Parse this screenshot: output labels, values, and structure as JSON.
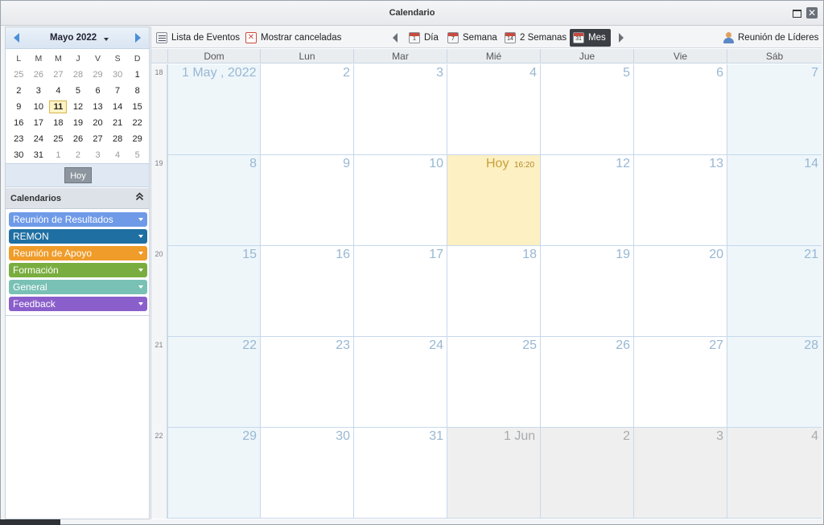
{
  "window": {
    "title": "Calendario",
    "close_glyph": "✕"
  },
  "mini_calendar": {
    "month_label": "Mayo 2022",
    "weekday_headers": [
      "L",
      "M",
      "M",
      "J",
      "V",
      "S",
      "D"
    ],
    "weeks": [
      [
        {
          "d": "25",
          "o": true
        },
        {
          "d": "26",
          "o": true
        },
        {
          "d": "27",
          "o": true
        },
        {
          "d": "28",
          "o": true
        },
        {
          "d": "29",
          "o": true
        },
        {
          "d": "30",
          "o": true
        },
        {
          "d": "1",
          "o": false
        }
      ],
      [
        {
          "d": "2",
          "o": false
        },
        {
          "d": "3",
          "o": false
        },
        {
          "d": "4",
          "o": false
        },
        {
          "d": "5",
          "o": false
        },
        {
          "d": "6",
          "o": false
        },
        {
          "d": "7",
          "o": false
        },
        {
          "d": "8",
          "o": false
        }
      ],
      [
        {
          "d": "9",
          "o": false
        },
        {
          "d": "10",
          "o": false
        },
        {
          "d": "11",
          "o": false,
          "today": true
        },
        {
          "d": "12",
          "o": false
        },
        {
          "d": "13",
          "o": false
        },
        {
          "d": "14",
          "o": false
        },
        {
          "d": "15",
          "o": false
        }
      ],
      [
        {
          "d": "16",
          "o": false
        },
        {
          "d": "17",
          "o": false
        },
        {
          "d": "18",
          "o": false
        },
        {
          "d": "19",
          "o": false
        },
        {
          "d": "20",
          "o": false
        },
        {
          "d": "21",
          "o": false
        },
        {
          "d": "22",
          "o": false
        }
      ],
      [
        {
          "d": "23",
          "o": false
        },
        {
          "d": "24",
          "o": false
        },
        {
          "d": "25",
          "o": false
        },
        {
          "d": "26",
          "o": false
        },
        {
          "d": "27",
          "o": false
        },
        {
          "d": "28",
          "o": false
        },
        {
          "d": "29",
          "o": false
        }
      ],
      [
        {
          "d": "30",
          "o": false
        },
        {
          "d": "31",
          "o": false
        },
        {
          "d": "1",
          "o": true
        },
        {
          "d": "2",
          "o": true
        },
        {
          "d": "3",
          "o": true
        },
        {
          "d": "4",
          "o": true
        },
        {
          "d": "5",
          "o": true
        }
      ]
    ],
    "today_button": "Hoy"
  },
  "calendars": {
    "section_label": "Calendarios",
    "collapse_glyph": "≈",
    "items": [
      {
        "label": "Reunión de Resultados",
        "color": "#6f9ae8"
      },
      {
        "label": "REMON",
        "color": "#1f6fa3"
      },
      {
        "label": "Reunión de Apoyo",
        "color": "#ef9c2a"
      },
      {
        "label": "Formación",
        "color": "#7aad3f"
      },
      {
        "label": "General",
        "color": "#79c1b5"
      },
      {
        "label": "Feedback",
        "color": "#8b5fcb"
      }
    ]
  },
  "toolbar": {
    "event_list": "Lista de Eventos",
    "show_cancelled": "Mostrar canceladas",
    "view_day": "Día",
    "view_week": "Semana",
    "view_two_weeks": "2 Semanas",
    "view_month": "Mes",
    "leaders_meeting": "Reunión de Líderes",
    "icon_day_num": "1",
    "icon_week_num": "7",
    "icon_two_weeks_num": "14",
    "icon_month_num": "31"
  },
  "month_view": {
    "weekdays": [
      "Dom",
      "Lun",
      "Mar",
      "Mié",
      "Jue",
      "Vie",
      "Sáb"
    ],
    "weeks": [
      {
        "num": "18",
        "days": [
          {
            "label": "1 May , 2022",
            "type": "weekend first"
          },
          {
            "label": "2",
            "type": ""
          },
          {
            "label": "3",
            "type": ""
          },
          {
            "label": "4",
            "type": ""
          },
          {
            "label": "5",
            "type": ""
          },
          {
            "label": "6",
            "type": ""
          },
          {
            "label": "7",
            "type": "weekend"
          }
        ]
      },
      {
        "num": "19",
        "days": [
          {
            "label": "8",
            "type": "weekend"
          },
          {
            "label": "9",
            "type": ""
          },
          {
            "label": "10",
            "type": ""
          },
          {
            "label": "Hoy",
            "type": "today",
            "time": "16:20"
          },
          {
            "label": "12",
            "type": ""
          },
          {
            "label": "13",
            "type": ""
          },
          {
            "label": "14",
            "type": "weekend"
          }
        ]
      },
      {
        "num": "20",
        "days": [
          {
            "label": "15",
            "type": "weekend"
          },
          {
            "label": "16",
            "type": ""
          },
          {
            "label": "17",
            "type": ""
          },
          {
            "label": "18",
            "type": ""
          },
          {
            "label": "19",
            "type": ""
          },
          {
            "label": "20",
            "type": ""
          },
          {
            "label": "21",
            "type": "weekend"
          }
        ]
      },
      {
        "num": "21",
        "days": [
          {
            "label": "22",
            "type": "weekend"
          },
          {
            "label": "23",
            "type": ""
          },
          {
            "label": "24",
            "type": ""
          },
          {
            "label": "25",
            "type": ""
          },
          {
            "label": "26",
            "type": ""
          },
          {
            "label": "27",
            "type": ""
          },
          {
            "label": "28",
            "type": "weekend"
          }
        ]
      },
      {
        "num": "22",
        "days": [
          {
            "label": "29",
            "type": "weekend"
          },
          {
            "label": "30",
            "type": ""
          },
          {
            "label": "31",
            "type": ""
          },
          {
            "label": "1 Jun",
            "type": "other junfirst"
          },
          {
            "label": "2",
            "type": "other"
          },
          {
            "label": "3",
            "type": "other"
          },
          {
            "label": "4",
            "type": "other"
          }
        ]
      }
    ]
  }
}
